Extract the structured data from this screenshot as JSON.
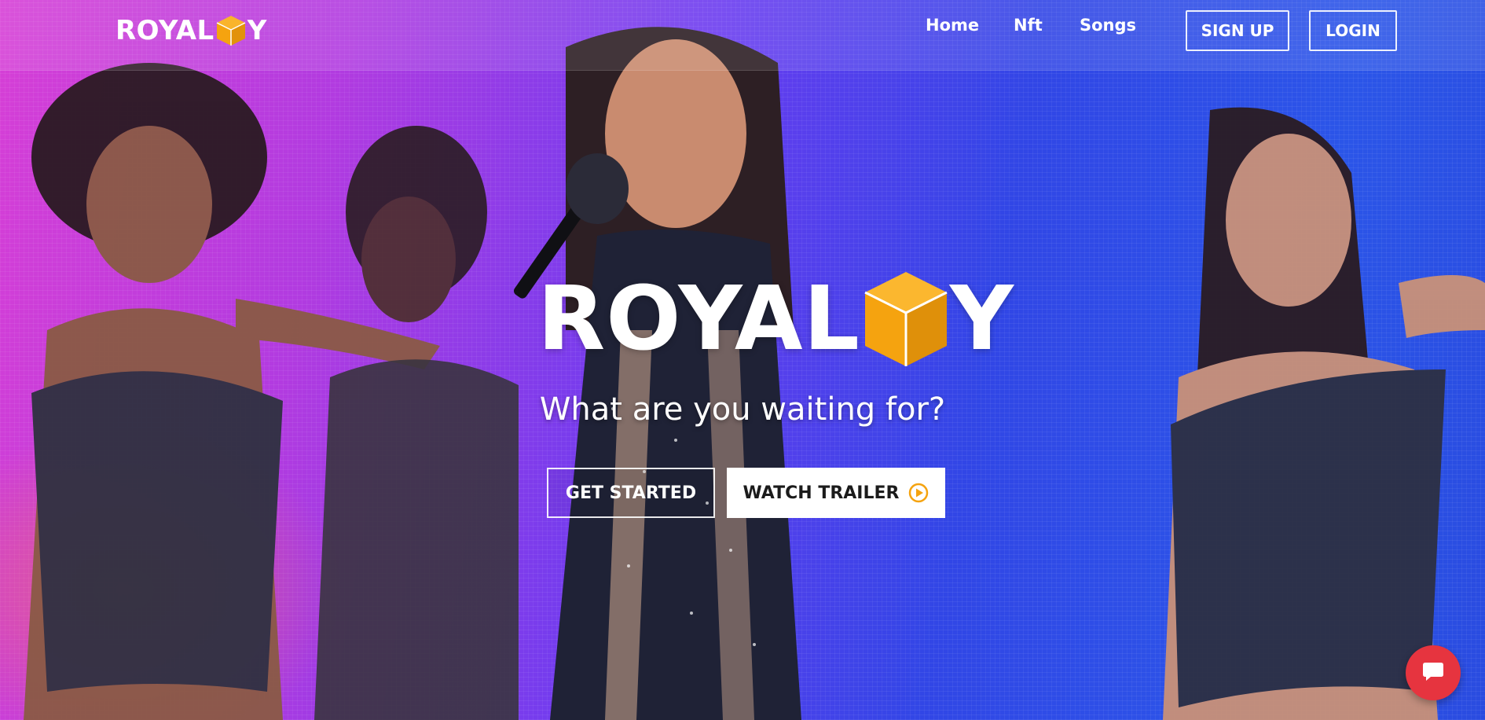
{
  "brand": {
    "name_prefix": "ROYAL",
    "name_suffix": "Y",
    "cube_icon": "cube-icon",
    "accent_color": "#f5a30f"
  },
  "nav": {
    "items": [
      {
        "label": "Home"
      },
      {
        "label": "Nft"
      },
      {
        "label": "Songs"
      }
    ],
    "signup_label": "SIGN UP",
    "login_label": "LOGIN"
  },
  "hero": {
    "title_prefix": "ROYAL",
    "title_suffix": "Y",
    "tagline": "What are you waiting for?",
    "get_started_label": "GET STARTED",
    "watch_trailer_label": "WATCH TRAILER",
    "trailer_icon": "play-circle-icon"
  },
  "chat": {
    "icon": "chat-bubble-icon",
    "color": "#e6343f"
  }
}
